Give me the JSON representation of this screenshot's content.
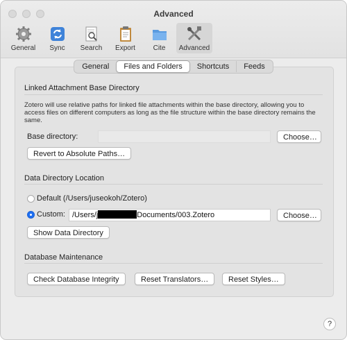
{
  "window": {
    "title": "Advanced"
  },
  "toolbar": [
    {
      "label": "General",
      "icon": "gear-icon"
    },
    {
      "label": "Sync",
      "icon": "sync-icon"
    },
    {
      "label": "Search",
      "icon": "search-icon"
    },
    {
      "label": "Export",
      "icon": "clipboard-icon"
    },
    {
      "label": "Cite",
      "icon": "folder-icon"
    },
    {
      "label": "Advanced",
      "icon": "tools-icon",
      "active": true
    }
  ],
  "tabs": [
    {
      "label": "General"
    },
    {
      "label": "Files and Folders",
      "selected": true
    },
    {
      "label": "Shortcuts"
    },
    {
      "label": "Feeds"
    }
  ],
  "linked": {
    "title": "Linked Attachment Base Directory",
    "description": "Zotero will use relative paths for linked file attachments within the base directory, allowing you to access files on different computers as long as the file structure within the base directory remains the same.",
    "base_label": "Base directory:",
    "base_value": "",
    "choose_label": "Choose…",
    "revert_label": "Revert to Absolute Paths…"
  },
  "data_dir": {
    "title": "Data Directory Location",
    "default_label": "Default (/Users/juseokoh/Zotero)",
    "custom_label": "Custom:",
    "custom_path_prefix": "/Users/j",
    "custom_path_suffix": "Documents/003.Zotero",
    "choose_label": "Choose…",
    "show_label": "Show Data Directory",
    "selected": "custom"
  },
  "maintenance": {
    "title": "Database Maintenance",
    "check_label": "Check Database Integrity",
    "reset_translators_label": "Reset Translators…",
    "reset_styles_label": "Reset Styles…"
  },
  "help_label": "?",
  "colors": {
    "accent": "#1e6ff2"
  }
}
